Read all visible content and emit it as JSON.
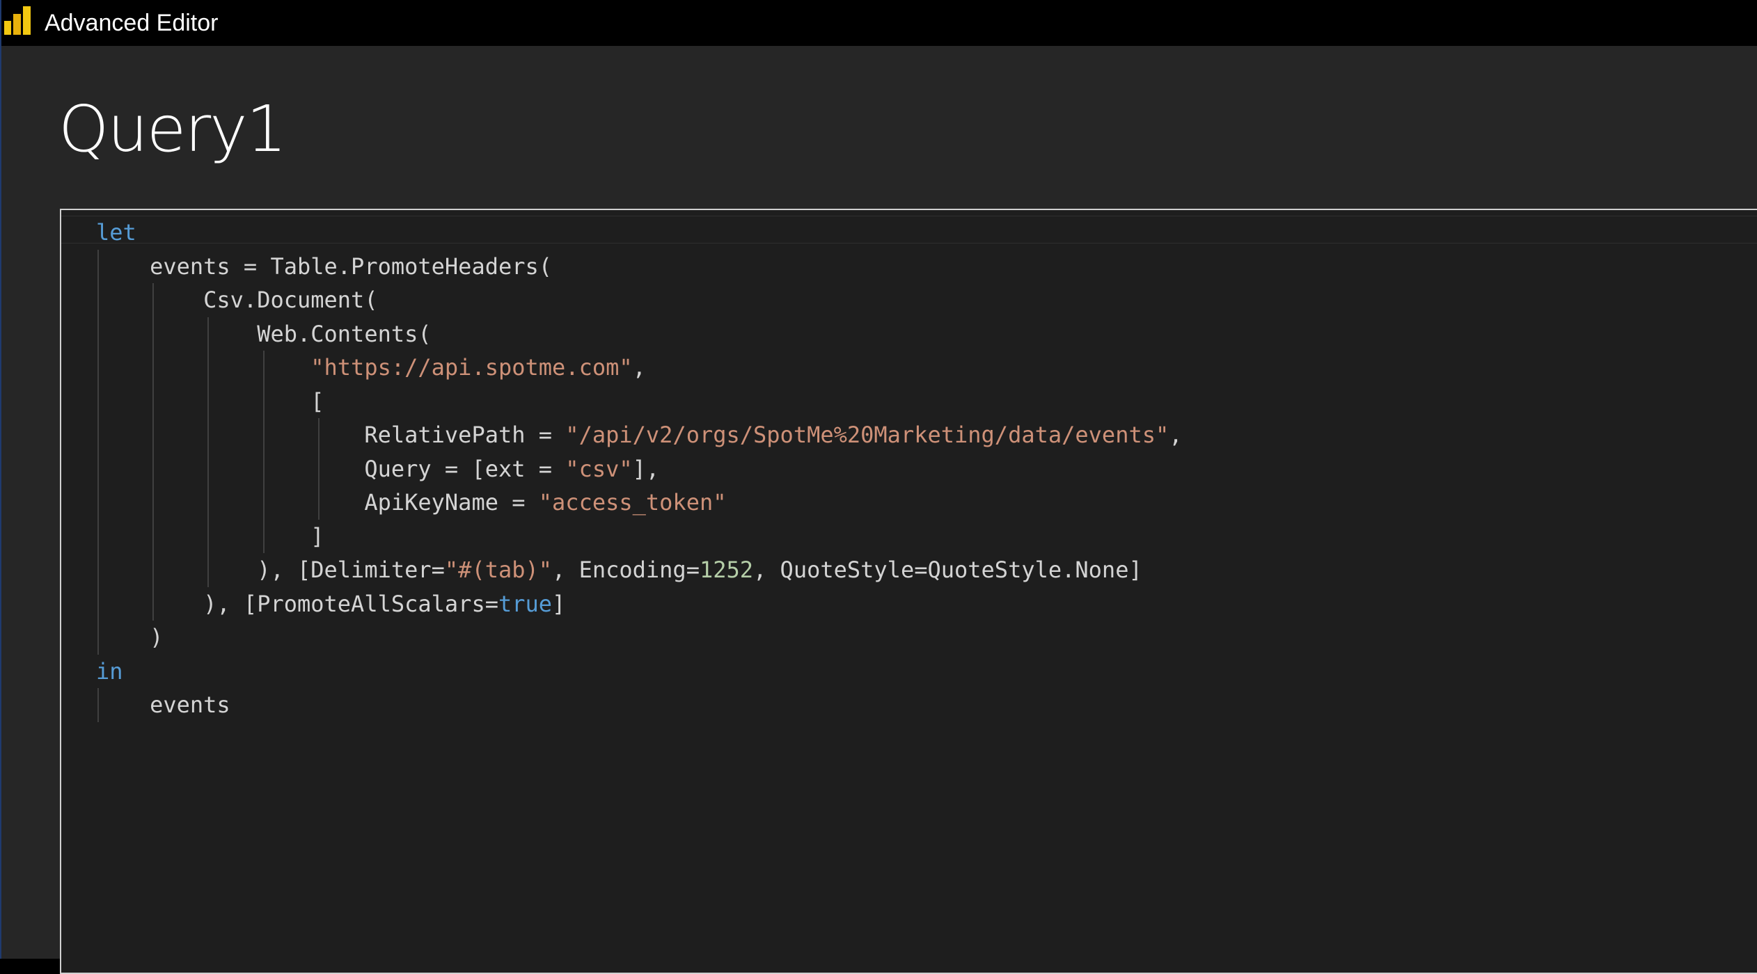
{
  "window": {
    "title": "Advanced Editor",
    "app_icon": "power-bi-logo-icon",
    "accent_color": "#f2c811"
  },
  "query": {
    "name": "Query1"
  },
  "editor": {
    "colors": {
      "keyword": "#569cd6",
      "string": "#ce9178",
      "number": "#b5cea8",
      "text": "#d4d4d4",
      "background": "#1e1e1e"
    },
    "lines": [
      {
        "indent": 0,
        "tokens": [
          {
            "t": "kw",
            "v": "let"
          }
        ]
      },
      {
        "indent": 1,
        "tokens": [
          {
            "t": "txt",
            "v": "events = Table.PromoteHeaders("
          }
        ]
      },
      {
        "indent": 2,
        "tokens": [
          {
            "t": "txt",
            "v": "Csv.Document("
          }
        ]
      },
      {
        "indent": 3,
        "tokens": [
          {
            "t": "txt",
            "v": "Web.Contents("
          }
        ]
      },
      {
        "indent": 4,
        "tokens": [
          {
            "t": "str",
            "v": "\"https://api.spotme.com\""
          },
          {
            "t": "txt",
            "v": ","
          }
        ]
      },
      {
        "indent": 4,
        "tokens": [
          {
            "t": "txt",
            "v": "["
          }
        ]
      },
      {
        "indent": 5,
        "tokens": [
          {
            "t": "txt",
            "v": "RelativePath = "
          },
          {
            "t": "str",
            "v": "\"/api/v2/orgs/SpotMe%20Marketing/data/events\""
          },
          {
            "t": "txt",
            "v": ","
          }
        ]
      },
      {
        "indent": 5,
        "tokens": [
          {
            "t": "txt",
            "v": "Query = [ext = "
          },
          {
            "t": "str",
            "v": "\"csv\""
          },
          {
            "t": "txt",
            "v": "],"
          }
        ]
      },
      {
        "indent": 5,
        "tokens": [
          {
            "t": "txt",
            "v": "ApiKeyName = "
          },
          {
            "t": "str",
            "v": "\"access_token\""
          }
        ]
      },
      {
        "indent": 4,
        "tokens": [
          {
            "t": "txt",
            "v": "]"
          }
        ]
      },
      {
        "indent": 3,
        "tokens": [
          {
            "t": "txt",
            "v": "), [Delimiter="
          },
          {
            "t": "str",
            "v": "\"#(tab)\""
          },
          {
            "t": "txt",
            "v": ", Encoding="
          },
          {
            "t": "num",
            "v": "1252"
          },
          {
            "t": "txt",
            "v": ", QuoteStyle=QuoteStyle.None]"
          }
        ]
      },
      {
        "indent": 2,
        "tokens": [
          {
            "t": "txt",
            "v": "), [PromoteAllScalars="
          },
          {
            "t": "kw",
            "v": "true"
          },
          {
            "t": "txt",
            "v": "]"
          }
        ]
      },
      {
        "indent": 1,
        "tokens": [
          {
            "t": "txt",
            "v": ")"
          }
        ]
      },
      {
        "indent": 0,
        "tokens": [
          {
            "t": "kw",
            "v": "in"
          }
        ]
      },
      {
        "indent": 1,
        "tokens": [
          {
            "t": "txt",
            "v": "events"
          }
        ]
      }
    ]
  }
}
